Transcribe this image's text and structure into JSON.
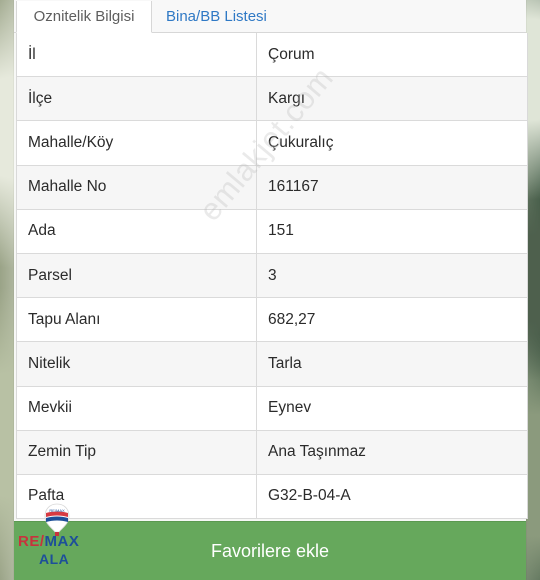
{
  "tabs": [
    {
      "label": "Oznitelik Bilgisi",
      "active": true
    },
    {
      "label": "Bina/BB Listesi",
      "active": false
    }
  ],
  "rows": [
    {
      "label": "İl",
      "value": "Çorum"
    },
    {
      "label": "İlçe",
      "value": "Kargı"
    },
    {
      "label": "Mahalle/Köy",
      "value": "Çukuralıç"
    },
    {
      "label": "Mahalle No",
      "value": "161167"
    },
    {
      "label": "Ada",
      "value": "151"
    },
    {
      "label": "Parsel",
      "value": "3"
    },
    {
      "label": "Tapu Alanı",
      "value": "682,27"
    },
    {
      "label": "Nitelik",
      "value": "Tarla"
    },
    {
      "label": "Mevkii",
      "value": "Eynev"
    },
    {
      "label": "Zemin Tip",
      "value": "Ana Taşınmaz"
    },
    {
      "label": "Pafta",
      "value": "G32-B-04-A"
    }
  ],
  "watermark": "emlakjet.com",
  "action_button": {
    "label": "Favorilere ekle",
    "color": "#66a85c"
  },
  "logo": {
    "brand_part1": "RE/",
    "brand_part2": "MAX",
    "sub": "ALA",
    "balloon_text": "RE/MAX",
    "icon": "remax-balloon-icon"
  }
}
